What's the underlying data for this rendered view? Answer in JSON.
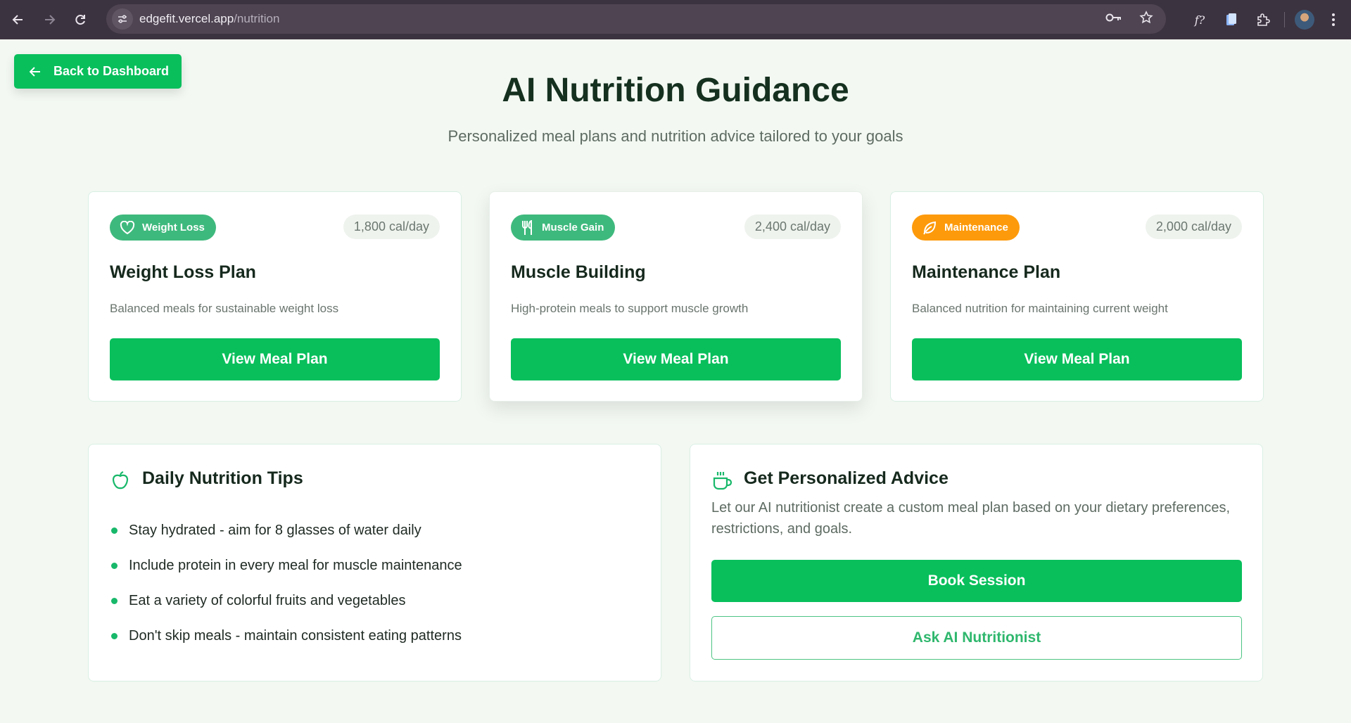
{
  "browser": {
    "url_host": "edgefit.vercel.app",
    "url_path": "/nutrition",
    "icons": [
      "back-icon",
      "forward-icon",
      "reload-icon",
      "site-settings-icon",
      "password-key-icon",
      "bookmark-star-icon",
      "extension-font-icon",
      "extension-doc-icon",
      "extensions-puzzle-icon",
      "profile-avatar",
      "menu-icon"
    ],
    "extension_font_label": "f?"
  },
  "back_button": {
    "label": "Back to Dashboard",
    "icon": "arrow-left-icon"
  },
  "header": {
    "title": "AI Nutrition Guidance",
    "subtitle": "Personalized meal plans and nutrition advice tailored to your goals"
  },
  "plans": [
    {
      "badge": "Weight Loss",
      "badge_icon": "heart-icon",
      "badge_color": "#3eb97d",
      "calories": "1,800 cal/day",
      "title": "Weight Loss Plan",
      "description": "Balanced meals for sustainable weight loss",
      "button": "View Meal Plan"
    },
    {
      "badge": "Muscle Gain",
      "badge_icon": "utensils-icon",
      "badge_color": "#3eb97d",
      "calories": "2,400 cal/day",
      "title": "Muscle Building",
      "description": "High-protein meals to support muscle growth",
      "button": "View Meal Plan"
    },
    {
      "badge": "Maintenance",
      "badge_icon": "leaf-icon",
      "badge_color": "#fd9a0b",
      "calories": "2,000 cal/day",
      "title": "Maintenance Plan",
      "description": "Balanced nutrition for maintaining current weight",
      "button": "View Meal Plan"
    }
  ],
  "tips_panel": {
    "title": "Daily Nutrition Tips",
    "icon": "apple-icon",
    "tips": [
      "Stay hydrated - aim for 8 glasses of water daily",
      "Include protein in every meal for muscle maintenance",
      "Eat a variety of colorful fruits and vegetables",
      "Don't skip meals - maintain consistent eating patterns"
    ]
  },
  "advice_panel": {
    "title": "Get Personalized Advice",
    "icon": "coffee-cup-icon",
    "text": "Let our AI nutritionist create a custom meal plan based on your dietary preferences, restrictions, and goals.",
    "primary_button": "Book Session",
    "secondary_button": "Ask AI Nutritionist"
  },
  "colors": {
    "brand_green": "#08bf5c",
    "badge_green": "#3eb97d",
    "badge_orange": "#fd9a0b",
    "page_background": "#f3f8f2"
  }
}
